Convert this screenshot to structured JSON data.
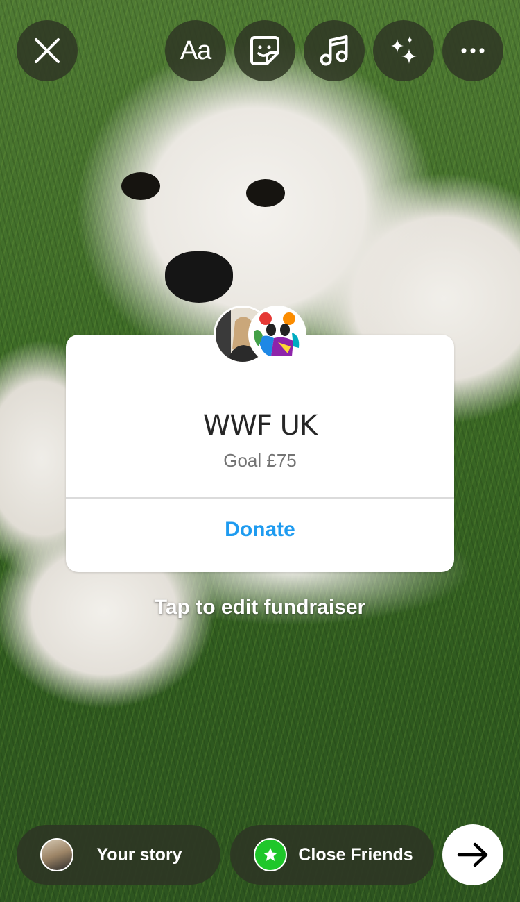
{
  "toolbar": {
    "text_tool_label": "Aa",
    "icons": [
      "close-icon",
      "sticker-icon",
      "music-icon",
      "effects-sparkles-icon",
      "more-icon"
    ]
  },
  "fundraiser": {
    "title": "WWF UK",
    "goal": "Goal £75",
    "donate_label": "Donate",
    "edit_hint": "Tap to edit fundraiser",
    "accent_color": "#1e9bf0"
  },
  "share": {
    "your_story_label": "Your story",
    "close_friends_label": "Close Friends",
    "close_friends_color": "#1fc72a"
  }
}
